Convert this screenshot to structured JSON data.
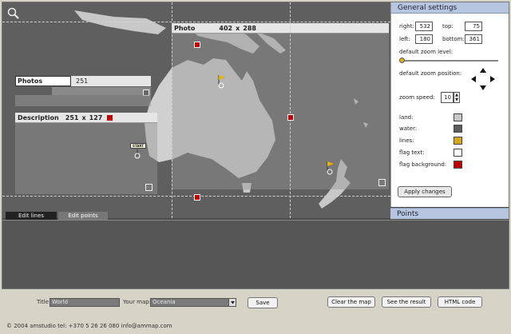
{
  "map": {
    "photo_panel": {
      "title": "Photo",
      "width": "402",
      "times": "x",
      "height": "288"
    },
    "photos_panel": {
      "input_value": "Photos",
      "count": "251"
    },
    "description_panel": {
      "title": "Description",
      "width": "251",
      "times": "x",
      "height": "127"
    },
    "start_label": "START"
  },
  "tabs": [
    {
      "label": "Edit lines"
    },
    {
      "label": "Edit points"
    }
  ],
  "settings": {
    "title": "General settings",
    "right_label": "right:",
    "right_value": "532",
    "top_label": "top:",
    "top_value": "75",
    "left_label": "left:",
    "left_value": "180",
    "bottom_label": "bottom:",
    "bottom_value": "361",
    "zoom_level_label": "default zoom level:",
    "zoom_level_fraction": 0.0,
    "zoom_position_label": "default zoom position:",
    "zoom_speed_label": "zoom speed:",
    "zoom_speed_value": "10",
    "colors": [
      {
        "label": "land:",
        "color": "#c8c8c8"
      },
      {
        "label": "water:",
        "color": "#5c5c5c"
      },
      {
        "label": "lines:",
        "color": "#d9a520"
      },
      {
        "label": "flag text:",
        "color": "#ffffff"
      },
      {
        "label": "flag background:",
        "color": "#c00000"
      }
    ],
    "apply_label": "Apply changes"
  },
  "points": {
    "title": "Points"
  },
  "toolbar": {
    "title_label": "Title",
    "title_value": "World",
    "your_map_label": "Your map:",
    "your_map_value": "Oceania",
    "save_label": "Save",
    "clear_label": "Clear the map",
    "see_label": "See the result",
    "html_label": "HTML code"
  },
  "footer": {
    "text": "© 2004 amstudio tel: +370 5 26 26 080 info@ammap.com"
  },
  "icons": {
    "zoom": "magnifier-icon",
    "arrows": "four-arrows-icon",
    "resize": "resize-icon",
    "flag": "flag-icon"
  },
  "accent": {
    "handle": "#c00000",
    "header": "#b7c6e0"
  }
}
